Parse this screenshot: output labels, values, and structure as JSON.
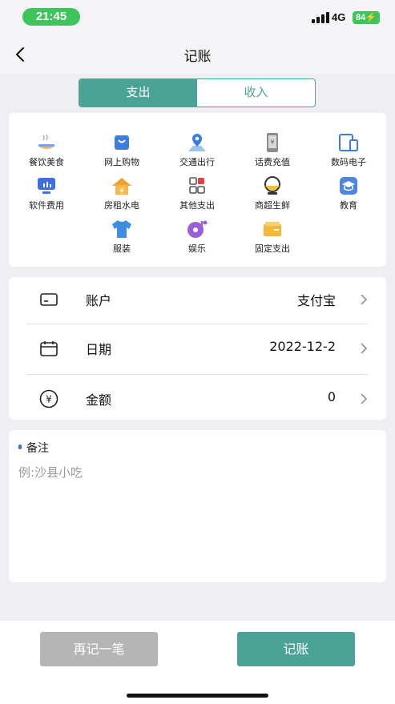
{
  "status_bar": {
    "time": "21:45",
    "network": "4G",
    "battery": "84"
  },
  "nav": {
    "title": "记账",
    "back_icon": "chevron-left-icon"
  },
  "segment": {
    "tabs": [
      {
        "label": "支出",
        "active": true
      },
      {
        "label": "收入",
        "active": false
      }
    ]
  },
  "categories": [
    {
      "label": "餐饮美食",
      "icon": "dining-icon"
    },
    {
      "label": "网上购物",
      "icon": "shopping-bag-icon"
    },
    {
      "label": "交通出行",
      "icon": "map-pin-icon"
    },
    {
      "label": "话费充值",
      "icon": "phone-topup-icon"
    },
    {
      "label": "数码电子",
      "icon": "devices-icon"
    },
    {
      "label": "软件费用",
      "icon": "software-icon"
    },
    {
      "label": "房租水电",
      "icon": "house-icon"
    },
    {
      "label": "其他支出",
      "icon": "grid-icon"
    },
    {
      "label": "商超生鲜",
      "icon": "groceries-icon"
    },
    {
      "label": "教育",
      "icon": "graduation-cap-icon"
    },
    {
      "label": "服装",
      "icon": "tshirt-icon"
    },
    {
      "label": "娱乐",
      "icon": "music-disc-icon"
    },
    {
      "label": "固定支出",
      "icon": "card-icon"
    }
  ],
  "form": {
    "account": {
      "label": "账户",
      "value": "支付宝",
      "icon": "card-outline-icon"
    },
    "date": {
      "label": "日期",
      "value": "2022-12-2",
      "icon": "calendar-icon"
    },
    "amount": {
      "label": "金额",
      "value": "0",
      "icon": "yuan-circle-icon"
    }
  },
  "note": {
    "label": "备注",
    "placeholder": "例:沙县小吃"
  },
  "actions": {
    "again_label": "再记一笔",
    "save_label": "记账"
  },
  "colors": {
    "accent": "#4aa395",
    "disabled": "#b5b5b5",
    "status_green": "#3ec45a",
    "background": "#eeeef3"
  }
}
